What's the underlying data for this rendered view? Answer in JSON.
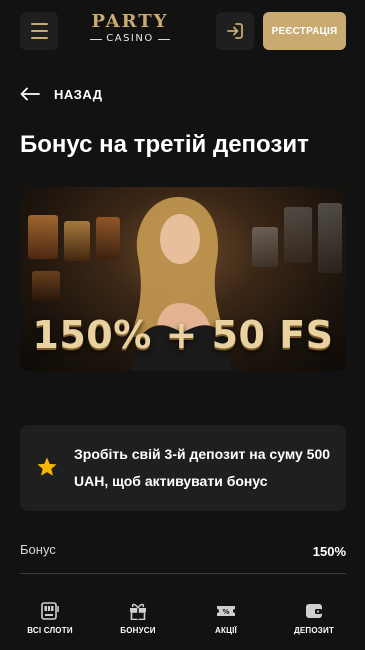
{
  "header": {
    "logo_top": "PARTY",
    "logo_bottom": "CASINO",
    "register_label": "РЕЄСТРАЦІЯ",
    "accent_color": "#c9ab72"
  },
  "back_label": "НАЗАД",
  "page_title": "Бонус на третій депозит",
  "banner": {
    "offer_text": "150% + 50 FS"
  },
  "info_card": {
    "icon": "star-icon",
    "text": "Зробіть свій 3-й депозит на суму 500 UAH, щоб активувати бонус"
  },
  "details": [
    {
      "label": "Бонус",
      "value": "150%"
    }
  ],
  "bottom_nav": [
    {
      "label": "ВСІ СЛОТИ",
      "icon": "slot-machine-icon"
    },
    {
      "label": "БОНУСИ",
      "icon": "gift-icon"
    },
    {
      "label": "АКЦІЇ",
      "icon": "coupon-icon"
    },
    {
      "label": "ДЕПОЗИТ",
      "icon": "wallet-icon"
    }
  ]
}
